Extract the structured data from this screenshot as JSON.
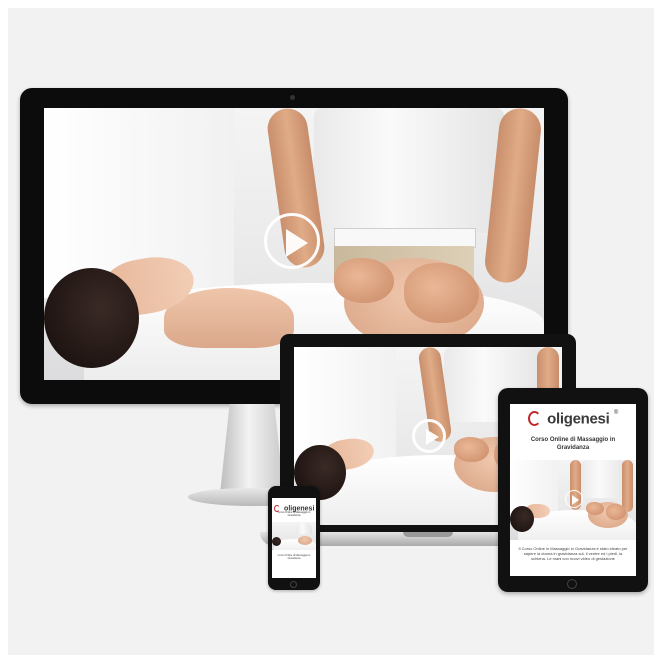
{
  "brand": {
    "name": "oligenesi",
    "mark": "®",
    "accent": "#c0282d"
  },
  "tablet": {
    "title": "Corso Online di Massaggio in Gravidanza",
    "description": "Il Corso Online in Massaggio in Gravidanza è stato ideato per sapere la donna in gravidanza sul, il ventre ed i piedi, la schiena. Le mani con nuovi video di gestazione"
  },
  "phone": {
    "title": "Corso Online di Massaggio in Gravidanza",
    "description": "Corso Online di Massaggio in Gravidanza"
  },
  "icons": {
    "play": "play-icon",
    "logo": "oligenesi-logo-icon"
  }
}
